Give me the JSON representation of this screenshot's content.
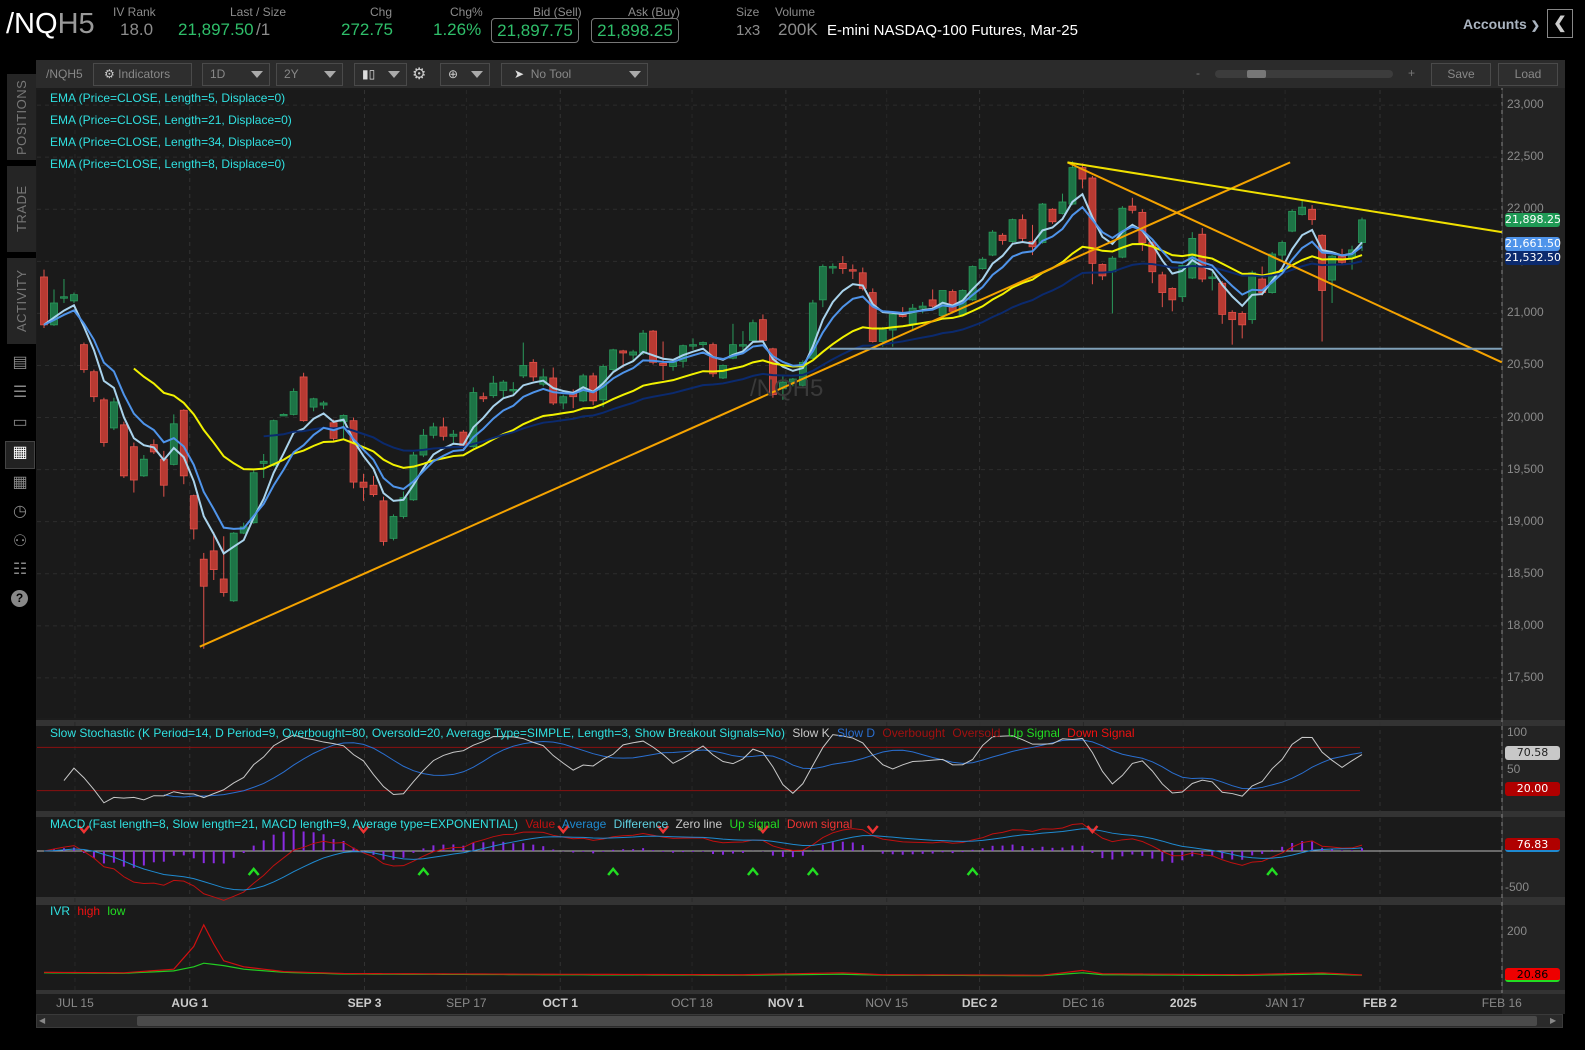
{
  "header": {
    "symbol_root": "/NQ",
    "symbol_suffix": "H5",
    "iv_rank_label": "IV Rank",
    "iv_rank": "18.0",
    "last_size_label": "Last / Size",
    "last": "21,897.50",
    "size": "/1",
    "chg_label": "Chg",
    "chg": "272.75",
    "chg_pct_label": "Chg%",
    "chg_pct": "1.26%",
    "bid_label": "Bid (Sell)",
    "bid": "21,897.75",
    "ask_label": "Ask (Buy)",
    "ask": "21,898.25",
    "size_label": "Size",
    "size_value": "1x3",
    "volume_label": "Volume",
    "volume": "200K",
    "description": "E-mini NASDAQ-100 Futures, Mar-25",
    "accounts": "Accounts"
  },
  "sidebar": {
    "tabs": [
      "POSITIONS",
      "TRADE",
      "ACTIVITY"
    ],
    "icons": [
      "chart-report-icon",
      "list-icon",
      "tv-icon",
      "chart-icon",
      "grid-icon",
      "clock-icon",
      "people-icon",
      "calendar-icon",
      "help-icon"
    ]
  },
  "toolbar": {
    "symbol": "/NQH5",
    "indicators": "Indicators",
    "aggregation": "1D",
    "period": "2Y",
    "tool": "No Tool",
    "zoom_minus": "-",
    "zoom_plus": "+",
    "zoom_level": 0.2,
    "save": "Save",
    "load": "Load"
  },
  "chart_data": {
    "type": "candlestick",
    "title": "/NQH5",
    "watermark": "/NQH5",
    "ylim": [
      17115,
      23145
    ],
    "y_ticks": [
      17500,
      18000,
      18500,
      19000,
      19500,
      20000,
      20500,
      21000,
      21500,
      22000,
      22500,
      23000
    ],
    "y_tick_labels": [
      "17,500",
      "18,000",
      "18,500",
      "19,000",
      "19,500",
      "20,000",
      "20,500",
      "21,000",
      "21,500",
      "22,000",
      "22,500",
      "23,000"
    ],
    "x_ticks": [
      {
        "label": "JUL 15",
        "bar": 3.1,
        "major": false
      },
      {
        "label": "AUG 1",
        "bar": 14.6,
        "major": true
      },
      {
        "label": "SEP 3",
        "bar": 32.1,
        "major": true
      },
      {
        "label": "SEP 17",
        "bar": 42.3,
        "major": false
      },
      {
        "label": "OCT 1",
        "bar": 51.7,
        "major": true
      },
      {
        "label": "OCT 18",
        "bar": 64.9,
        "major": false
      },
      {
        "label": "NOV 1",
        "bar": 74.3,
        "major": true
      },
      {
        "label": "NOV 15",
        "bar": 84.4,
        "major": false
      },
      {
        "label": "DEC 2",
        "bar": 93.7,
        "major": true
      },
      {
        "label": "DEC 16",
        "bar": 104.1,
        "major": false
      },
      {
        "label": "2025",
        "bar": 114.1,
        "major": true
      },
      {
        "label": "JAN 17",
        "bar": 124.3,
        "major": false
      },
      {
        "label": "FEB 2",
        "bar": 133.8,
        "major": true
      },
      {
        "label": "FEB 16",
        "bar": 146,
        "major": false
      }
    ],
    "ohlc": [
      [
        21350,
        21420,
        20860,
        20890
      ],
      [
        20890,
        21230,
        20880,
        21100
      ],
      [
        21160,
        21330,
        21100,
        21160
      ],
      [
        21120,
        21200,
        21100,
        21180
      ],
      [
        20700,
        20720,
        20430,
        20460
      ],
      [
        20440,
        20460,
        20150,
        20200
      ],
      [
        20170,
        20190,
        19720,
        19760
      ],
      [
        19900,
        20190,
        19880,
        20150
      ],
      [
        19930,
        19960,
        19420,
        19440
      ],
      [
        19720,
        19760,
        19280,
        19400
      ],
      [
        19440,
        19640,
        19430,
        19600
      ],
      [
        19740,
        19790,
        19650,
        19670
      ],
      [
        19600,
        19680,
        19240,
        19350
      ],
      [
        19550,
        20030,
        19540,
        19940
      ],
      [
        20070,
        20080,
        19360,
        19440
      ],
      [
        19250,
        19260,
        18830,
        18930
      ],
      [
        18640,
        18700,
        17780,
        18380
      ],
      [
        18720,
        18900,
        18440,
        18540
      ],
      [
        18450,
        18860,
        18280,
        18320
      ],
      [
        18240,
        18900,
        18230,
        18890
      ],
      [
        18890,
        18990,
        18880,
        18950
      ],
      [
        18990,
        19500,
        18980,
        19470
      ],
      [
        19560,
        19650,
        19420,
        19580
      ],
      [
        19540,
        19980,
        19530,
        19970
      ],
      [
        20030,
        20040,
        20020,
        20030
      ],
      [
        20030,
        20280,
        20020,
        20250
      ],
      [
        20390,
        20430,
        19960,
        19970
      ],
      [
        20100,
        20190,
        20060,
        20180
      ],
      [
        20120,
        20160,
        20080,
        20140
      ],
      [
        19950,
        19980,
        19780,
        19800
      ],
      [
        19960,
        20030,
        19800,
        20020
      ],
      [
        19970,
        20000,
        19320,
        19380
      ],
      [
        19380,
        19460,
        19200,
        19330
      ],
      [
        19350,
        19440,
        19240,
        19260
      ],
      [
        19200,
        19240,
        18770,
        18810
      ],
      [
        18840,
        19070,
        18820,
        19050
      ],
      [
        19050,
        19290,
        19030,
        19230
      ],
      [
        19210,
        19670,
        19200,
        19640
      ],
      [
        19640,
        19890,
        19620,
        19830
      ],
      [
        19830,
        19950,
        19800,
        19910
      ],
      [
        19910,
        20000,
        19780,
        19820
      ],
      [
        19820,
        19880,
        19740,
        19840
      ],
      [
        19860,
        19880,
        19700,
        19720
      ],
      [
        19720,
        20290,
        19710,
        20240
      ],
      [
        20200,
        20240,
        20150,
        20180
      ],
      [
        20210,
        20400,
        20190,
        20330
      ],
      [
        20260,
        20360,
        20180,
        20340
      ],
      [
        20260,
        20340,
        20220,
        20270
      ],
      [
        20400,
        20720,
        20380,
        20500
      ],
      [
        20530,
        20560,
        20350,
        20390
      ],
      [
        20320,
        20470,
        20300,
        20390
      ],
      [
        20380,
        20480,
        20120,
        20140
      ],
      [
        20140,
        20220,
        20080,
        20200
      ],
      [
        20230,
        20270,
        20090,
        20200
      ],
      [
        20160,
        20420,
        20150,
        20400
      ],
      [
        20400,
        20430,
        20120,
        20160
      ],
      [
        20170,
        20510,
        20100,
        20490
      ],
      [
        20460,
        20660,
        20440,
        20650
      ],
      [
        20640,
        20650,
        20480,
        20620
      ],
      [
        20600,
        20650,
        20550,
        20630
      ],
      [
        20620,
        20840,
        20600,
        20810
      ],
      [
        20830,
        20840,
        20510,
        20530
      ],
      [
        20520,
        20730,
        20360,
        20500
      ],
      [
        20490,
        20560,
        20450,
        20530
      ],
      [
        20540,
        20700,
        20480,
        20690
      ],
      [
        20690,
        20760,
        20650,
        20700
      ],
      [
        20700,
        20730,
        20680,
        20720
      ],
      [
        20700,
        20720,
        20390,
        20420
      ],
      [
        20380,
        20510,
        20370,
        20500
      ],
      [
        20570,
        20900,
        20560,
        20700
      ],
      [
        20700,
        20830,
        20640,
        20700
      ],
      [
        20740,
        20940,
        20720,
        20910
      ],
      [
        20940,
        20990,
        20730,
        20740
      ],
      [
        20660,
        20670,
        20190,
        20220
      ],
      [
        20280,
        20410,
        20170,
        20340
      ],
      [
        20340,
        20380,
        20300,
        20370
      ],
      [
        20310,
        20550,
        20300,
        20530
      ],
      [
        20570,
        21130,
        20560,
        21100
      ],
      [
        21130,
        21470,
        21060,
        21450
      ],
      [
        21440,
        21480,
        21380,
        21450
      ],
      [
        21480,
        21550,
        21380,
        21430
      ],
      [
        21420,
        21470,
        21330,
        21410
      ],
      [
        21390,
        21440,
        21220,
        21240
      ],
      [
        21200,
        21240,
        20720,
        20730
      ],
      [
        20730,
        20870,
        20680,
        20860
      ],
      [
        20840,
        21000,
        20680,
        20990
      ],
      [
        20990,
        21060,
        20960,
        20970
      ],
      [
        20900,
        21090,
        20830,
        21050
      ],
      [
        21050,
        21110,
        21000,
        21070
      ],
      [
        21130,
        21230,
        21030,
        21070
      ],
      [
        20980,
        21220,
        20970,
        21220
      ],
      [
        21210,
        21230,
        21000,
        21020
      ],
      [
        20990,
        21230,
        20980,
        21220
      ],
      [
        21130,
        21460,
        21120,
        21450
      ],
      [
        21430,
        21540,
        21420,
        21520
      ],
      [
        21560,
        21800,
        21550,
        21780
      ],
      [
        21750,
        21770,
        21660,
        21700
      ],
      [
        21690,
        21910,
        21680,
        21900
      ],
      [
        21900,
        21950,
        21690,
        21720
      ],
      [
        21690,
        21850,
        21560,
        21640
      ],
      [
        21680,
        22060,
        21670,
        22050
      ],
      [
        22000,
        22010,
        21860,
        21880
      ],
      [
        21960,
        22150,
        21950,
        22070
      ],
      [
        22050,
        22460,
        22040,
        22400
      ],
      [
        22400,
        22440,
        22200,
        22290
      ],
      [
        22300,
        22320,
        21280,
        21480
      ],
      [
        21470,
        21480,
        21320,
        21360
      ],
      [
        21400,
        21550,
        21000,
        21530
      ],
      [
        21540,
        22030,
        21530,
        22010
      ],
      [
        22030,
        22110,
        21960,
        21990
      ],
      [
        21970,
        22000,
        21600,
        21680
      ],
      [
        21680,
        21690,
        21290,
        21400
      ],
      [
        21370,
        21400,
        21060,
        21200
      ],
      [
        21240,
        21250,
        21020,
        21130
      ],
      [
        21160,
        21470,
        21110,
        21460
      ],
      [
        21340,
        21780,
        21330,
        21720
      ],
      [
        21760,
        21820,
        21300,
        21330
      ],
      [
        21350,
        21400,
        21220,
        21350
      ],
      [
        21290,
        21310,
        20900,
        20990
      ],
      [
        21010,
        21030,
        20700,
        20940
      ],
      [
        21000,
        21020,
        20760,
        20890
      ],
      [
        20940,
        21410,
        20900,
        21390
      ],
      [
        21330,
        21450,
        21170,
        21200
      ],
      [
        21200,
        21590,
        21190,
        21570
      ],
      [
        21560,
        21700,
        21500,
        21680
      ],
      [
        21790,
        22000,
        21780,
        21980
      ],
      [
        21950,
        22080,
        21940,
        22020
      ],
      [
        22000,
        22040,
        21850,
        21900
      ],
      [
        21750,
        21760,
        20730,
        21220
      ],
      [
        21320,
        21560,
        21100,
        21550
      ],
      [
        21550,
        21620,
        21460,
        21490
      ],
      [
        21530,
        21650,
        21420,
        21610
      ],
      [
        21680,
        21920,
        21600,
        21898
      ]
    ],
    "studies": [
      {
        "label": "EMA (Price=CLOSE, Length=5, Displace=0)",
        "length": 5,
        "color": "#a9d3ec"
      },
      {
        "label": "EMA (Price=CLOSE, Length=21, Displace=0)",
        "length": 21,
        "color": "#f2f200"
      },
      {
        "label": "EMA (Price=CLOSE, Length=34, Displace=0)",
        "length": 34,
        "color": "#0b2a6e"
      },
      {
        "label": "EMA (Price=CLOSE, Length=8, Displace=0)",
        "length": 8,
        "color": "#4f94ea"
      }
    ],
    "price_badges": [
      {
        "value": "21,898.25",
        "color": "#1f9a55",
        "text": "#fff"
      },
      {
        "value": "21,661.50",
        "color": "#4f94ea",
        "text": "#fff"
      },
      {
        "value": "21,532.50",
        "color": "#0b2a6e",
        "text": "#fff"
      }
    ],
    "drawings": [
      {
        "name": "uptrend-line",
        "color": "#f5a300",
        "from": [
          15.6,
          17800
        ],
        "to": [
          124.8,
          22450
        ]
      },
      {
        "name": "downtrend-line-steep",
        "color": "#f5a300",
        "from": [
          102.5,
          22450
        ],
        "to": [
          146,
          20530
        ]
      },
      {
        "name": "downtrend-line-upper",
        "color": "#f0e000",
        "from": [
          102.5,
          22450
        ],
        "to": [
          146,
          21780
        ]
      },
      {
        "name": "support-line",
        "color": "#7fa0b8",
        "from": [
          78.7,
          20660
        ],
        "to": [
          146,
          20660
        ]
      }
    ],
    "stochastic": {
      "label": "Slow Stochastic (K Period=14, D Period=9, Overbought=80, Oversold=20, Average Type=SIMPLE, Length=3, Show Breakout Signals=No)",
      "k_period": 14,
      "d_period": 9,
      "length": 3,
      "overbought": 80,
      "oversold": 20,
      "legend": [
        {
          "t": "Slow K",
          "c": "#c8c8c8"
        },
        {
          "t": "Slow D",
          "c": "#2a6fd0"
        },
        {
          "t": "Overbought",
          "c": "#a01010"
        },
        {
          "t": "Oversold",
          "c": "#a01010"
        },
        {
          "t": "Up Signal",
          "c": "#22dd22"
        },
        {
          "t": "Down Signal",
          "c": "#ee1111"
        }
      ],
      "axis": [
        "100",
        "50"
      ],
      "badges": [
        {
          "value": "70.58",
          "color": "#c8c8c8",
          "text": "#222"
        },
        {
          "value": "20.00",
          "color": "#b00000",
          "text": "#fff"
        }
      ]
    },
    "macd": {
      "label": "MACD (Fast length=8, Slow length=21, MACD length=9, Average type=EXPONENTIAL)",
      "fast": 8,
      "slow": 21,
      "signal": 9,
      "legend": [
        {
          "t": "Value",
          "c": "#c01010"
        },
        {
          "t": "Average",
          "c": "#1f8ad0"
        },
        {
          "t": "Difference",
          "c": "#5fd0e0"
        },
        {
          "t": "Zero line",
          "c": "#c8c8c8"
        },
        {
          "t": "Up signal",
          "c": "#22dd22"
        },
        {
          "t": "Down signal",
          "c": "#ee3333"
        }
      ],
      "axis": [
        "-500"
      ],
      "badge": {
        "value": "76.83",
        "color": "#b00000",
        "text": "#fff"
      }
    },
    "ivr": {
      "label": "IVR",
      "legend": [
        {
          "t": "high",
          "c": "#ee1111"
        },
        {
          "t": "low",
          "c": "#22dd22"
        }
      ],
      "axis": [
        "200"
      ],
      "high_points": [
        [
          0,
          32
        ],
        [
          8,
          30
        ],
        [
          13,
          45
        ],
        [
          15,
          140
        ],
        [
          16,
          230
        ],
        [
          17,
          150
        ],
        [
          18,
          80
        ],
        [
          20,
          55
        ],
        [
          24,
          35
        ],
        [
          30,
          27
        ],
        [
          50,
          24
        ],
        [
          70,
          22
        ],
        [
          80,
          30
        ],
        [
          84,
          22
        ],
        [
          100,
          20
        ],
        [
          104,
          40
        ],
        [
          106,
          26
        ],
        [
          120,
          22
        ],
        [
          128,
          30
        ],
        [
          132,
          21
        ]
      ],
      "low_points": [
        [
          0,
          30
        ],
        [
          8,
          28
        ],
        [
          13,
          38
        ],
        [
          15,
          55
        ],
        [
          16,
          70
        ],
        [
          18,
          60
        ],
        [
          20,
          45
        ],
        [
          24,
          32
        ],
        [
          30,
          25
        ],
        [
          50,
          22
        ],
        [
          70,
          20
        ],
        [
          80,
          24
        ],
        [
          84,
          20
        ],
        [
          100,
          18
        ],
        [
          104,
          30
        ],
        [
          106,
          22
        ],
        [
          120,
          19
        ],
        [
          128,
          25
        ],
        [
          132,
          20
        ]
      ],
      "badge": {
        "value": "20.86",
        "color": "#ee0000",
        "text": "#000"
      }
    }
  }
}
